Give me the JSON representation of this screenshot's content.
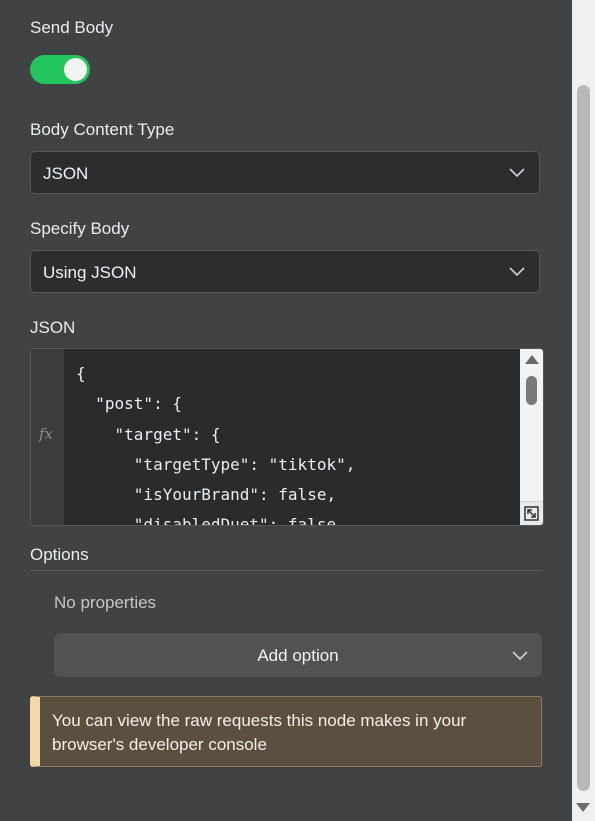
{
  "send_body": {
    "label": "Send Body",
    "enabled": true
  },
  "body_content_type": {
    "label": "Body Content Type",
    "value": "JSON"
  },
  "specify_body": {
    "label": "Specify Body",
    "value": "Using JSON"
  },
  "json_editor": {
    "label": "JSON",
    "expression_label": "fx",
    "lines": [
      "{",
      "  \"post\": {",
      "    \"target\": {",
      "      \"targetType\": \"tiktok\",",
      "      \"isYourBrand\": false,",
      "      \"disabledDuet\": false,"
    ]
  },
  "options": {
    "label": "Options",
    "empty_text": "No properties",
    "add_button_label": "Add option"
  },
  "notice": {
    "text": "You can view the raw requests this node makes in your browser's developer console"
  },
  "colors": {
    "toggle_on": "#22c55e",
    "notice_accent": "#f4d9a7",
    "notice_bg": "#5b4f3f"
  }
}
